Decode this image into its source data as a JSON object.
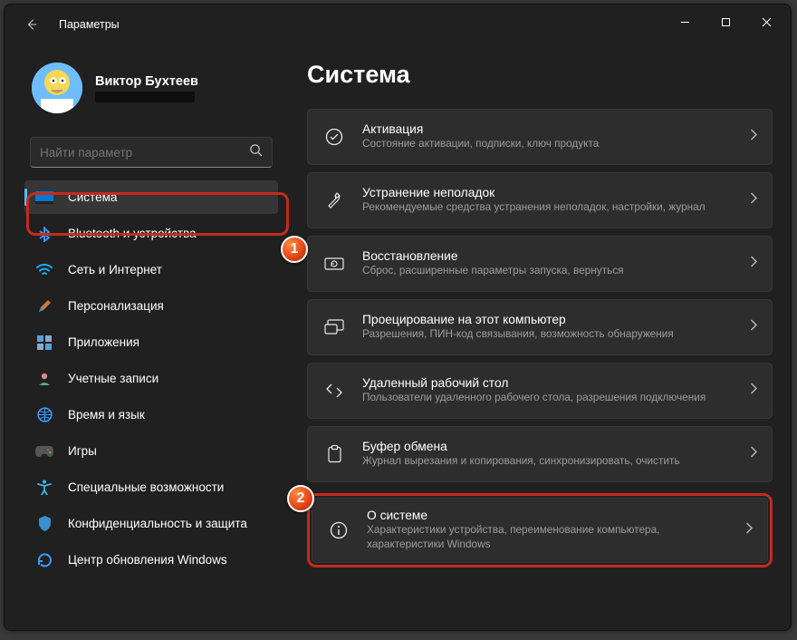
{
  "window": {
    "title": "Параметры"
  },
  "profile": {
    "name": "Виктор Бухтеев"
  },
  "search": {
    "placeholder": "Найти параметр"
  },
  "sidebar": {
    "items": [
      {
        "label": "Система",
        "icon": "system"
      },
      {
        "label": "Bluetooth и устройства",
        "icon": "bluetooth"
      },
      {
        "label": "Сеть и Интернет",
        "icon": "wifi"
      },
      {
        "label": "Персонализация",
        "icon": "brush"
      },
      {
        "label": "Приложения",
        "icon": "apps"
      },
      {
        "label": "Учетные записи",
        "icon": "account"
      },
      {
        "label": "Время и язык",
        "icon": "time"
      },
      {
        "label": "Игры",
        "icon": "games"
      },
      {
        "label": "Специальные возможности",
        "icon": "accessibility"
      },
      {
        "label": "Конфиденциальность и защита",
        "icon": "privacy"
      },
      {
        "label": "Центр обновления Windows",
        "icon": "update"
      }
    ]
  },
  "page": {
    "heading": "Система"
  },
  "cards": [
    {
      "title": "Активация",
      "desc": "Состояние активации, подписки, ключ продукта",
      "icon": "check"
    },
    {
      "title": "Устранение неполадок",
      "desc": "Рекомендуемые средства устранения неполадок, настройки, журнал",
      "icon": "wrench"
    },
    {
      "title": "Восстановление",
      "desc": "Сброс, расширенные параметры запуска, вернуться",
      "icon": "recover"
    },
    {
      "title": "Проецирование на этот компьютер",
      "desc": "Разрешения, ПИН-код связывания, возможность обнаружения",
      "icon": "project"
    },
    {
      "title": "Удаленный рабочий стол",
      "desc": "Пользователи удаленного рабочего стола, разрешения подключения",
      "icon": "remote"
    },
    {
      "title": "Буфер обмена",
      "desc": "Журнал вырезания и копирования, синхронизировать, очистить",
      "icon": "clipboard"
    },
    {
      "title": "О системе",
      "desc": "Характеристики устройства, переименование компьютера, характеристики Windows",
      "icon": "info"
    }
  ],
  "annotations": {
    "badge1": "1",
    "badge2": "2"
  }
}
